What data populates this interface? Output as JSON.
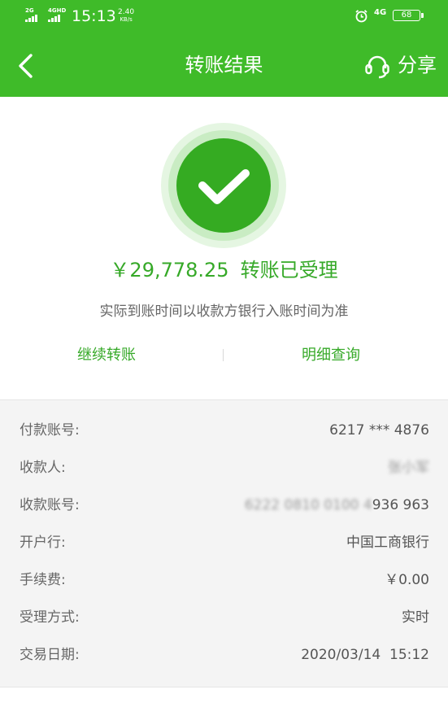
{
  "status_bar": {
    "signal_1": "2G",
    "signal_2": "4GHD",
    "time": "15:13",
    "speed_value": "2.40",
    "speed_unit": "KB/s",
    "network": "4G",
    "battery": "68"
  },
  "nav": {
    "title": "转账结果",
    "share_label": "分享"
  },
  "result": {
    "amount": "￥29,778.25",
    "status": "转账已受理",
    "note": "实际到账时间以收款方银行入账时间为准"
  },
  "actions": {
    "continue": "继续转账",
    "details": "明细查询"
  },
  "details": {
    "payer_account": {
      "label": "付款账号:",
      "value": "6217 *** 4876"
    },
    "payee": {
      "label": "收款人:",
      "value": "张小军"
    },
    "payee_account": {
      "label": "收款账号:",
      "value_hidden": "6222 0810 0100 4",
      "value_visible": "936 963"
    },
    "bank": {
      "label": "开户行:",
      "value": "中国工商银行"
    },
    "fee": {
      "label": "手续费:",
      "value": "￥0.00"
    },
    "method": {
      "label": "受理方式:",
      "value": "实时"
    },
    "date": {
      "label": "交易日期:",
      "value": "2020/03/14  15:12"
    }
  },
  "colors": {
    "header_green": "#3fbb29",
    "accent_green": "#36a928",
    "check_circle": "#35ab22"
  },
  "icons": {
    "back": "back-icon",
    "service": "headset-icon",
    "success": "check-icon",
    "alarm": "alarm-icon"
  }
}
